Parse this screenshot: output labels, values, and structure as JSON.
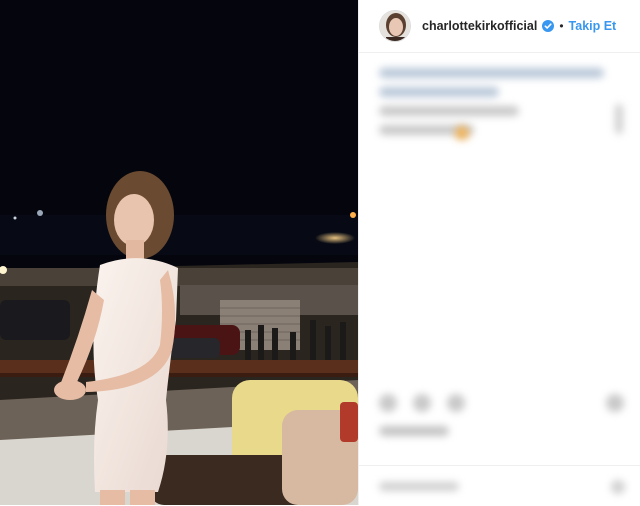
{
  "post": {
    "username": "charlottekirkofficial",
    "verified": true,
    "separator": "•",
    "follow_label": "Takip Et"
  },
  "icons": {
    "avatar": "profile-avatar",
    "verified": "verified-badge-icon",
    "like": "heart-icon",
    "comment": "comment-icon",
    "share": "share-icon",
    "save": "bookmark-icon",
    "more": "more-options-icon"
  },
  "colors": {
    "link_blue": "#3897f0",
    "verified_blue": "#3897f0",
    "text_dark": "#262626",
    "photo_night_sky": "#05060d"
  }
}
